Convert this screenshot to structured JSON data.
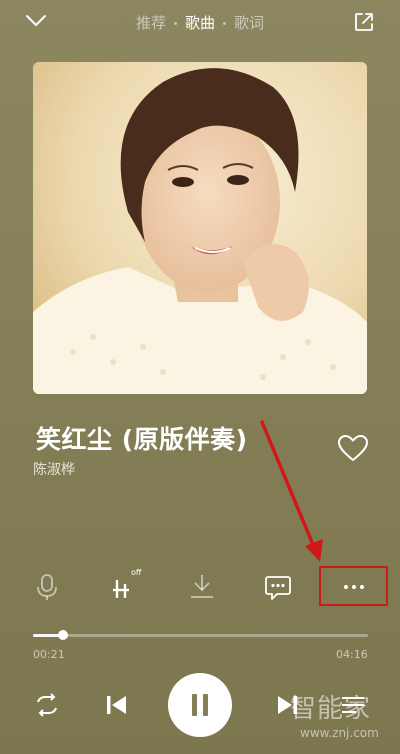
{
  "header": {
    "tabs": [
      {
        "label": "推荐"
      },
      {
        "label": "歌曲",
        "active": true
      },
      {
        "label": "歌词"
      }
    ],
    "icons": {
      "collapse": "chevron-down-icon",
      "share": "share-icon"
    }
  },
  "song": {
    "title": "笑红尘 (原版伴奏)",
    "artist": "陈淑桦",
    "liked": false
  },
  "actions": {
    "icons": [
      "mic-icon",
      "sound-effect-icon",
      "download-icon",
      "comment-icon",
      "more-icon"
    ],
    "sound_effect_badge": "off"
  },
  "progress": {
    "current": "00:21",
    "total": "04:16",
    "fraction": 0.09
  },
  "controls": {
    "icons": [
      "loop-icon",
      "previous-icon",
      "pause-icon",
      "next-icon",
      "playlist-icon"
    ]
  },
  "watermark": {
    "text": "智能家",
    "url": "www.znj.com"
  },
  "colors": {
    "background": "#857f57",
    "annotation": "#d01818"
  }
}
